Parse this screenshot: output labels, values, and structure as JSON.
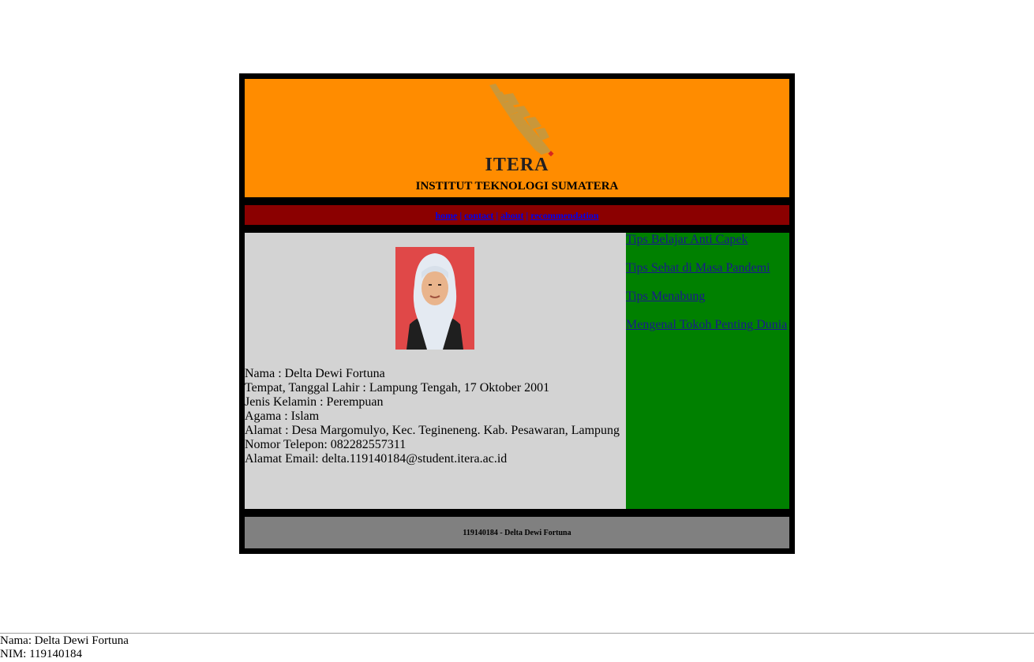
{
  "header": {
    "logo_text": "ITERA",
    "title": "INSTITUT TEKNOLOGI SUMATERA"
  },
  "nav": {
    "items": [
      "home",
      "contact",
      "about",
      "recommendation"
    ],
    "separator": "|"
  },
  "profile": {
    "photo_icon": "portrait-photo",
    "lines": [
      "Nama : Delta Dewi Fortuna",
      "Tempat, Tanggal Lahir : Lampung Tengah, 17 Oktober 2001",
      "Jenis Kelamin : Perempuan",
      "Agama : Islam",
      "Alamat : Desa Margomulyo, Kec. Tegineneng. Kab. Pesawaran, Lampung",
      "Nomor Telepon: 082282557311",
      "Alamat Email: delta.119140184@student.itera.ac.id"
    ]
  },
  "sidebar": {
    "links": [
      "Tips Belajar Anti Capek",
      "Tips Sehat di Masa Pandemi",
      "Tips Menabung",
      "Mengenal Tokoh Penting Dunia"
    ]
  },
  "footer": {
    "text": "119140184 - Delta Dewi Fortuna"
  },
  "bottom": {
    "name": "Nama: Delta Dewi Fortuna",
    "nim": "NIM: 119140184"
  },
  "colors": {
    "header_bg": "#ff8c00",
    "nav_bg": "#8b0000",
    "content_bg": "#d3d3d3",
    "sidebar_bg": "#008000",
    "footer_bg": "#808080",
    "frame": "#000000"
  }
}
